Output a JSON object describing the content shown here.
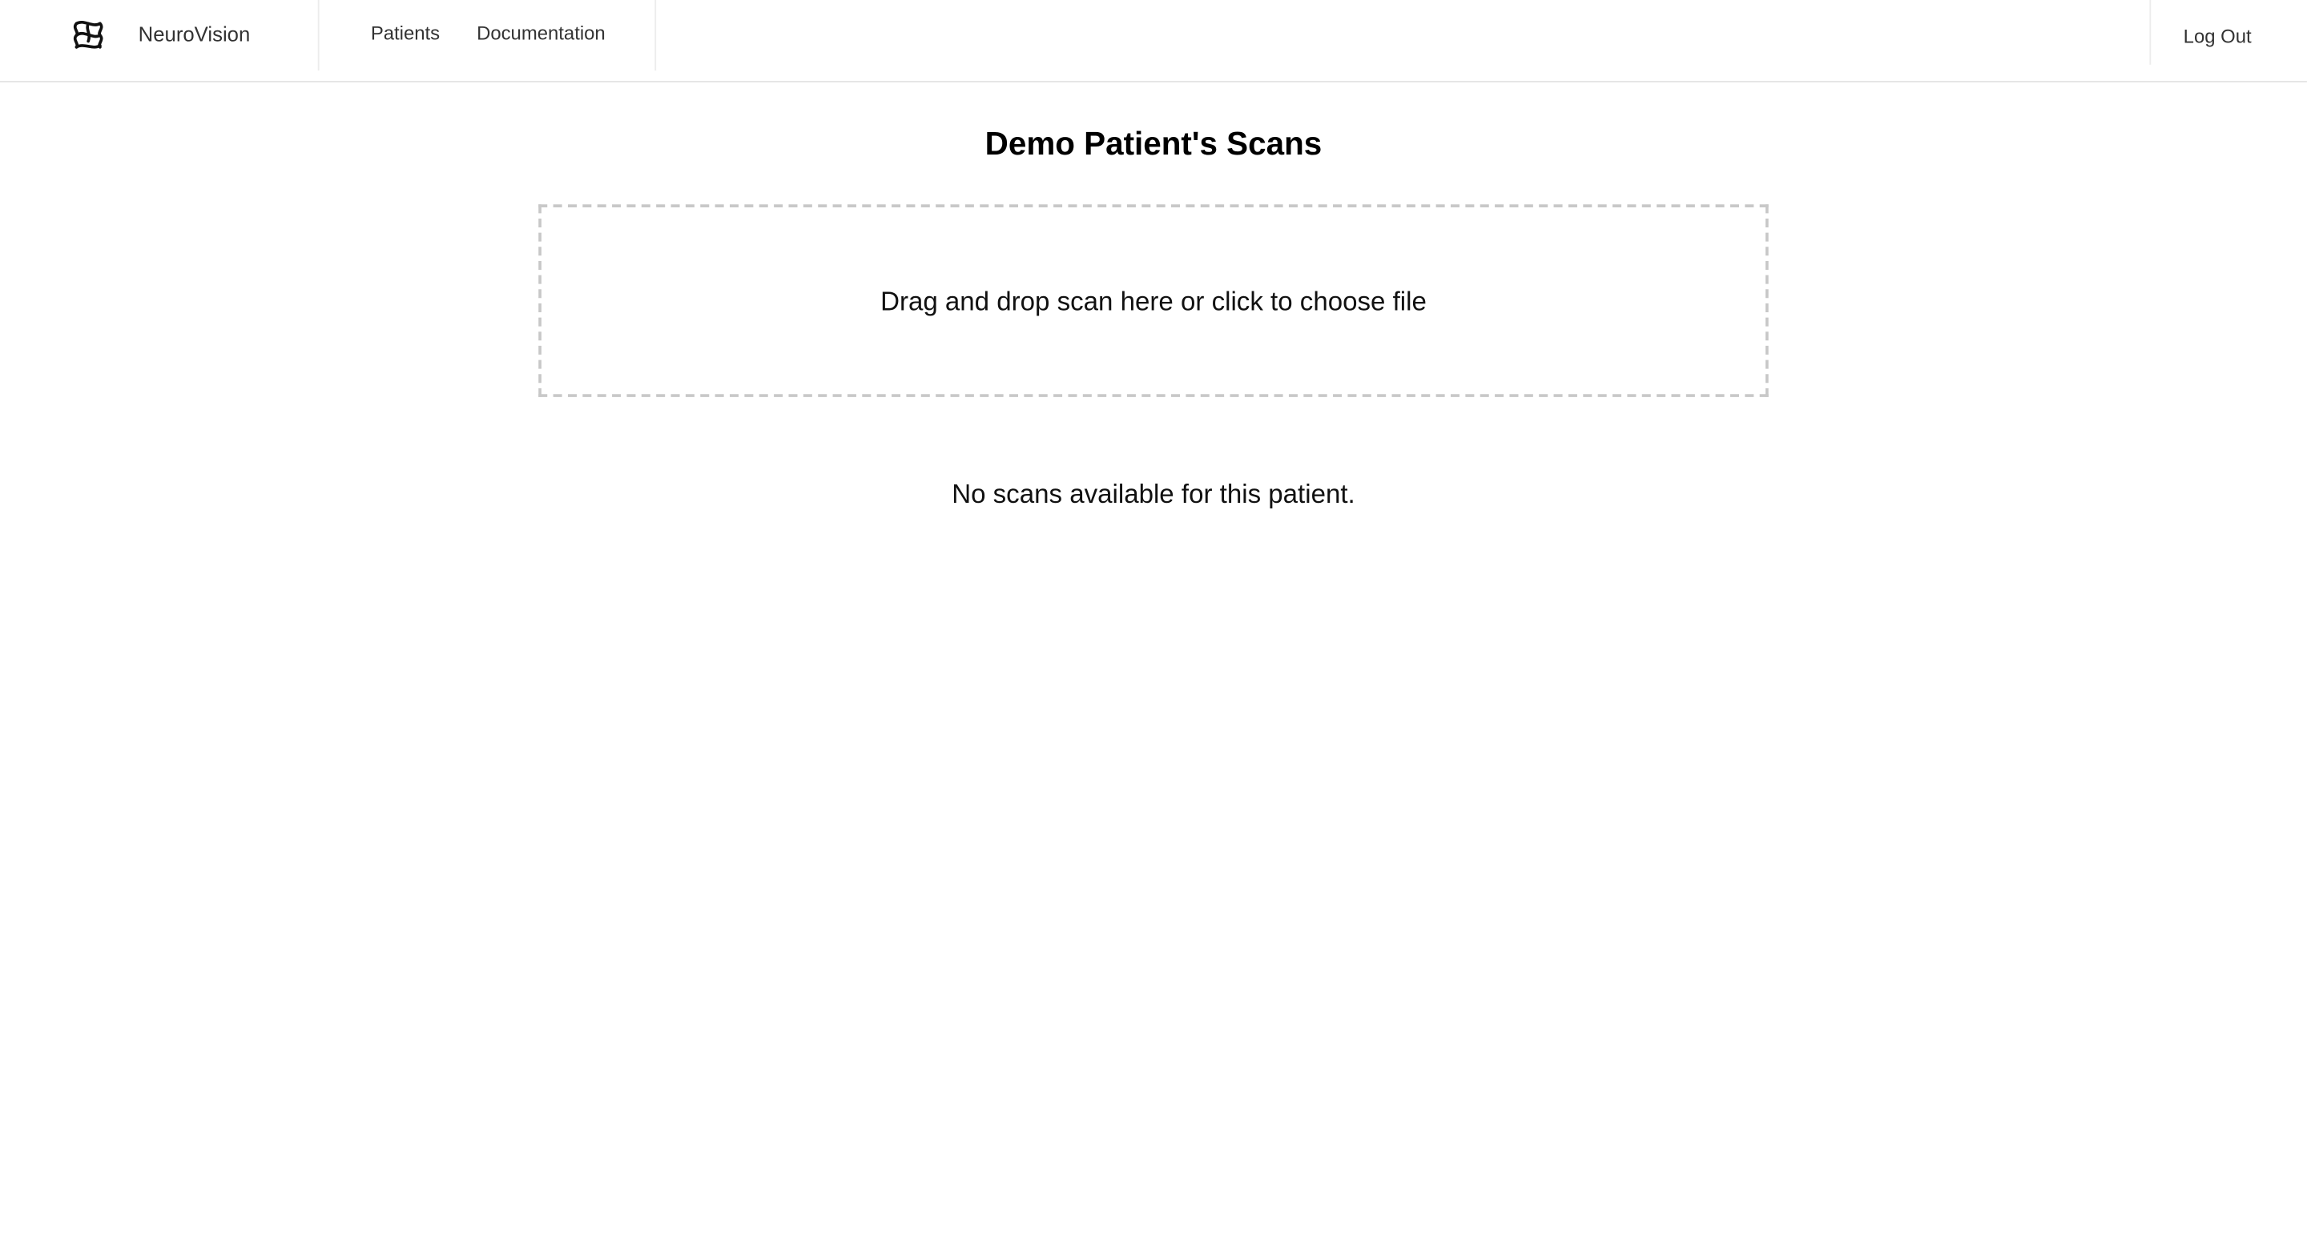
{
  "navbar": {
    "brand_name": "NeuroVision",
    "logo_icon": "brain-logo-icon",
    "links": {
      "patients": "Patients",
      "documentation": "Documentation"
    },
    "logout_label": "Log Out"
  },
  "main": {
    "title": "Demo Patient's Scans",
    "dropzone_text": "Drag and drop scan here or click to choose file",
    "empty_message": "No scans available for this patient."
  },
  "colors": {
    "background": "#ffffff",
    "text": "#111111",
    "nav_text": "#333333",
    "border": "#e5e5e5",
    "dropzone_border": "#c8c8c8"
  }
}
